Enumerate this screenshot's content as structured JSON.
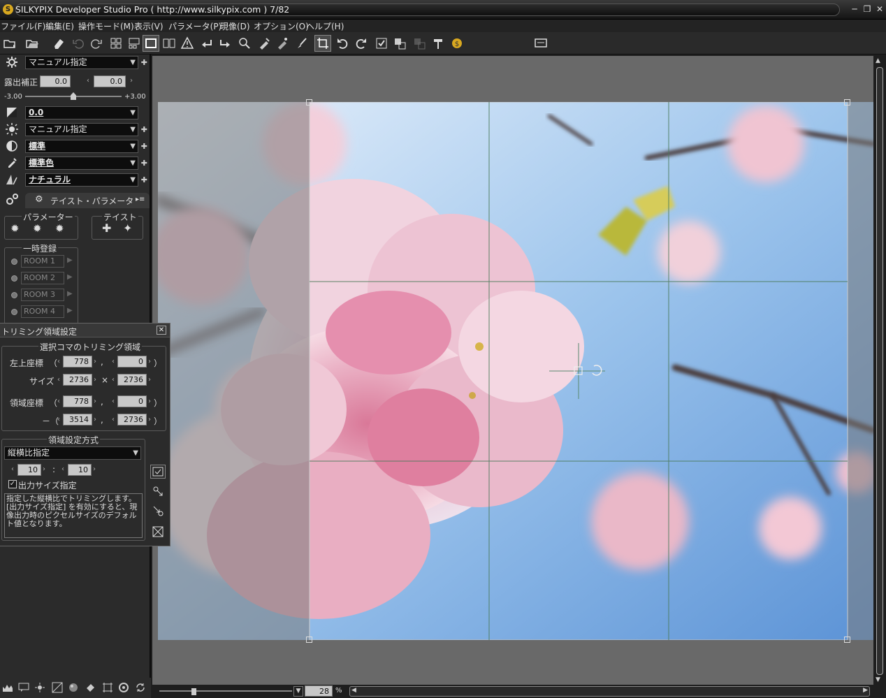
{
  "window": {
    "title": "SILKYPIX Developer Studio Pro ( http://www.silkypix.com )  7/82",
    "app_icon": "S"
  },
  "menu": [
    "ファイル(F)",
    "編集(E)",
    "操作モード(M)",
    "表示(V)",
    "パラメータ(P)",
    "現像(D)",
    "オプション(O)",
    "ヘルプ(H)"
  ],
  "toolbar_icons": [
    "open-icon",
    "open-folder-icon",
    "eraser-icon",
    "undo-icon",
    "redo-icon",
    "grid-view-icon",
    "preview-list-icon",
    "single-view-icon",
    "compare-view-icon",
    "warning-icon",
    "prev-icon",
    "next-icon",
    "zoom-icon",
    "spot-icon",
    "dust-icon",
    "brush-icon",
    "trim-tool-icon",
    "rotate-left-icon",
    "rotate-right-icon",
    "check-icon",
    "develop-icon",
    "batch-icon",
    "hammer-icon",
    "coin-icon",
    "monitor-icon"
  ],
  "left_panel": {
    "preset_select": "マニュアル指定",
    "exposure_label": "露出補正",
    "exposure_value": "0.0",
    "exposure_value2": "0.0",
    "slider_min": "-3.00",
    "slider_max": "+3.00",
    "slider_level": 0.5,
    "exposure_select": "0.0",
    "wb_select": "マニュアル指定",
    "contrast_select": "標準",
    "color_select": "標準色",
    "sharp_select": "ナチュラル",
    "taste_header": "テイスト・パラメータ",
    "parameter_group": "パラメーター",
    "taste_group": "テイスト",
    "temp_group": "一時登録",
    "rooms": [
      "ROOM 1",
      "ROOM 2",
      "ROOM 3",
      "ROOM 4"
    ]
  },
  "trim_panel": {
    "title": "トリミング領域設定",
    "group1": "選択コマのトリミング領域",
    "topleft_label": "左上座標",
    "topleft_x": "778",
    "topleft_y": "0",
    "size_label": "サイズ",
    "size_w": "2736",
    "size_h": "2736",
    "region_label": "領域座標",
    "region_x1": "778",
    "region_y1": "0",
    "region_x2": "3514",
    "region_y2": "2736",
    "group2": "領域設定方式",
    "method_select": "縦横比指定",
    "ratio_a": "10",
    "ratio_b": "10",
    "output_size_label": "出力サイズ指定",
    "output_size_checked": true,
    "help_text": "指定した縦横比でトリミングします。[出力サイズ指定] を有効にすると、現像出力時のピクセルサイズのデフォルト値となります。"
  },
  "status": {
    "zoom": "28",
    "zoom_unit": "%"
  },
  "colors": {
    "sky": "#7fb2e6",
    "blossom": "#e9a8bf"
  }
}
